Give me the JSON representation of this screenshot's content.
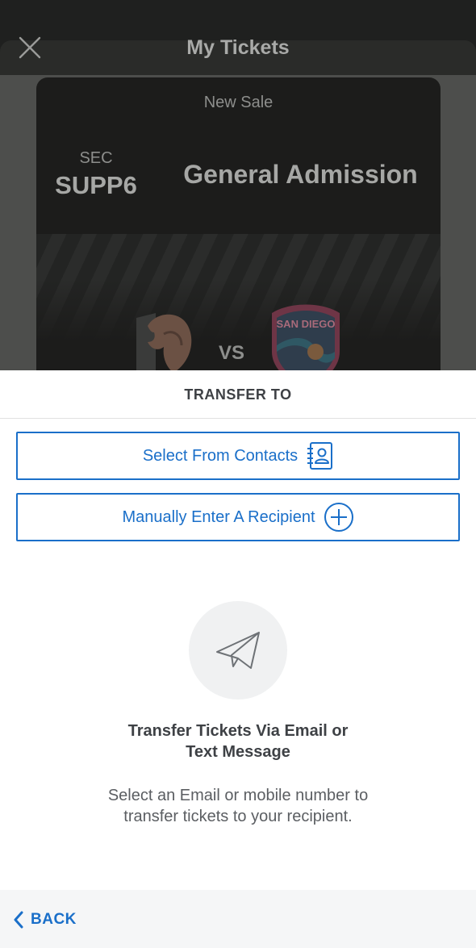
{
  "header": {
    "title": "My Tickets"
  },
  "ticket": {
    "sale_label": "New Sale",
    "section_label": "SEC",
    "section_value": "SUPP6",
    "admission": "General Admission",
    "vs_label": "VS",
    "right_crest_text": "SAN DIEGO"
  },
  "transfer": {
    "heading": "TRANSFER TO",
    "select_contacts_label": "Select From Contacts",
    "manual_recipient_label": "Manually Enter A Recipient",
    "info_title_line1": "Transfer Tickets Via Email or",
    "info_title_line2": "Text Message",
    "info_body_line1": "Select an Email or mobile number to",
    "info_body_line2": "transfer tickets to your recipient."
  },
  "footer": {
    "back_label": "BACK"
  },
  "colors": {
    "accent": "#1a6fc9",
    "text_dark": "#3e4145",
    "backdrop": "#4d4e4c"
  }
}
